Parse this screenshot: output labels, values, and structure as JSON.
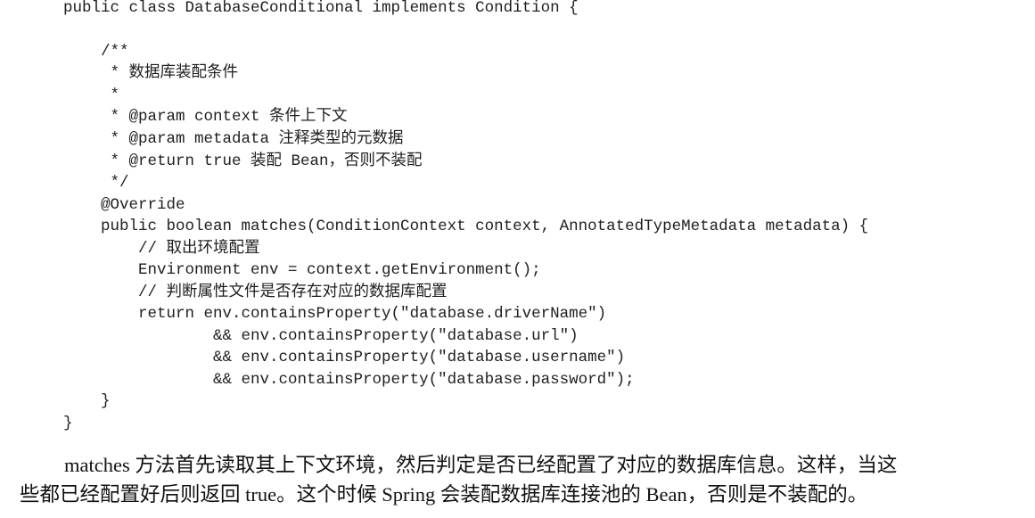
{
  "code": {
    "lines": [
      "public class DatabaseConditional implements Condition {",
      "",
      "    /**",
      "     * 数据库装配条件",
      "     *",
      "     * @param context 条件上下文",
      "     * @param metadata 注释类型的元数据",
      "     * @return true 装配 Bean，否则不装配",
      "     */",
      "    @Override",
      "    public boolean matches(ConditionContext context, AnnotatedTypeMetadata metadata) {",
      "        // 取出环境配置",
      "        Environment env = context.getEnvironment();",
      "        // 判断属性文件是否存在对应的数据库配置",
      "        return env.containsProperty(\"database.driverName\")",
      "                && env.containsProperty(\"database.url\")",
      "                && env.containsProperty(\"database.username\")",
      "                && env.containsProperty(\"database.password\");",
      "    }",
      "}"
    ]
  },
  "paragraph": {
    "line1": "matches 方法首先读取其上下文环境，然后判定是否已经配置了对应的数据库信息。这样，当这",
    "line2": "些都已经配置好后则返回 true。这个时候 Spring 会装配数据库连接池的 Bean，否则是不装配的。"
  }
}
